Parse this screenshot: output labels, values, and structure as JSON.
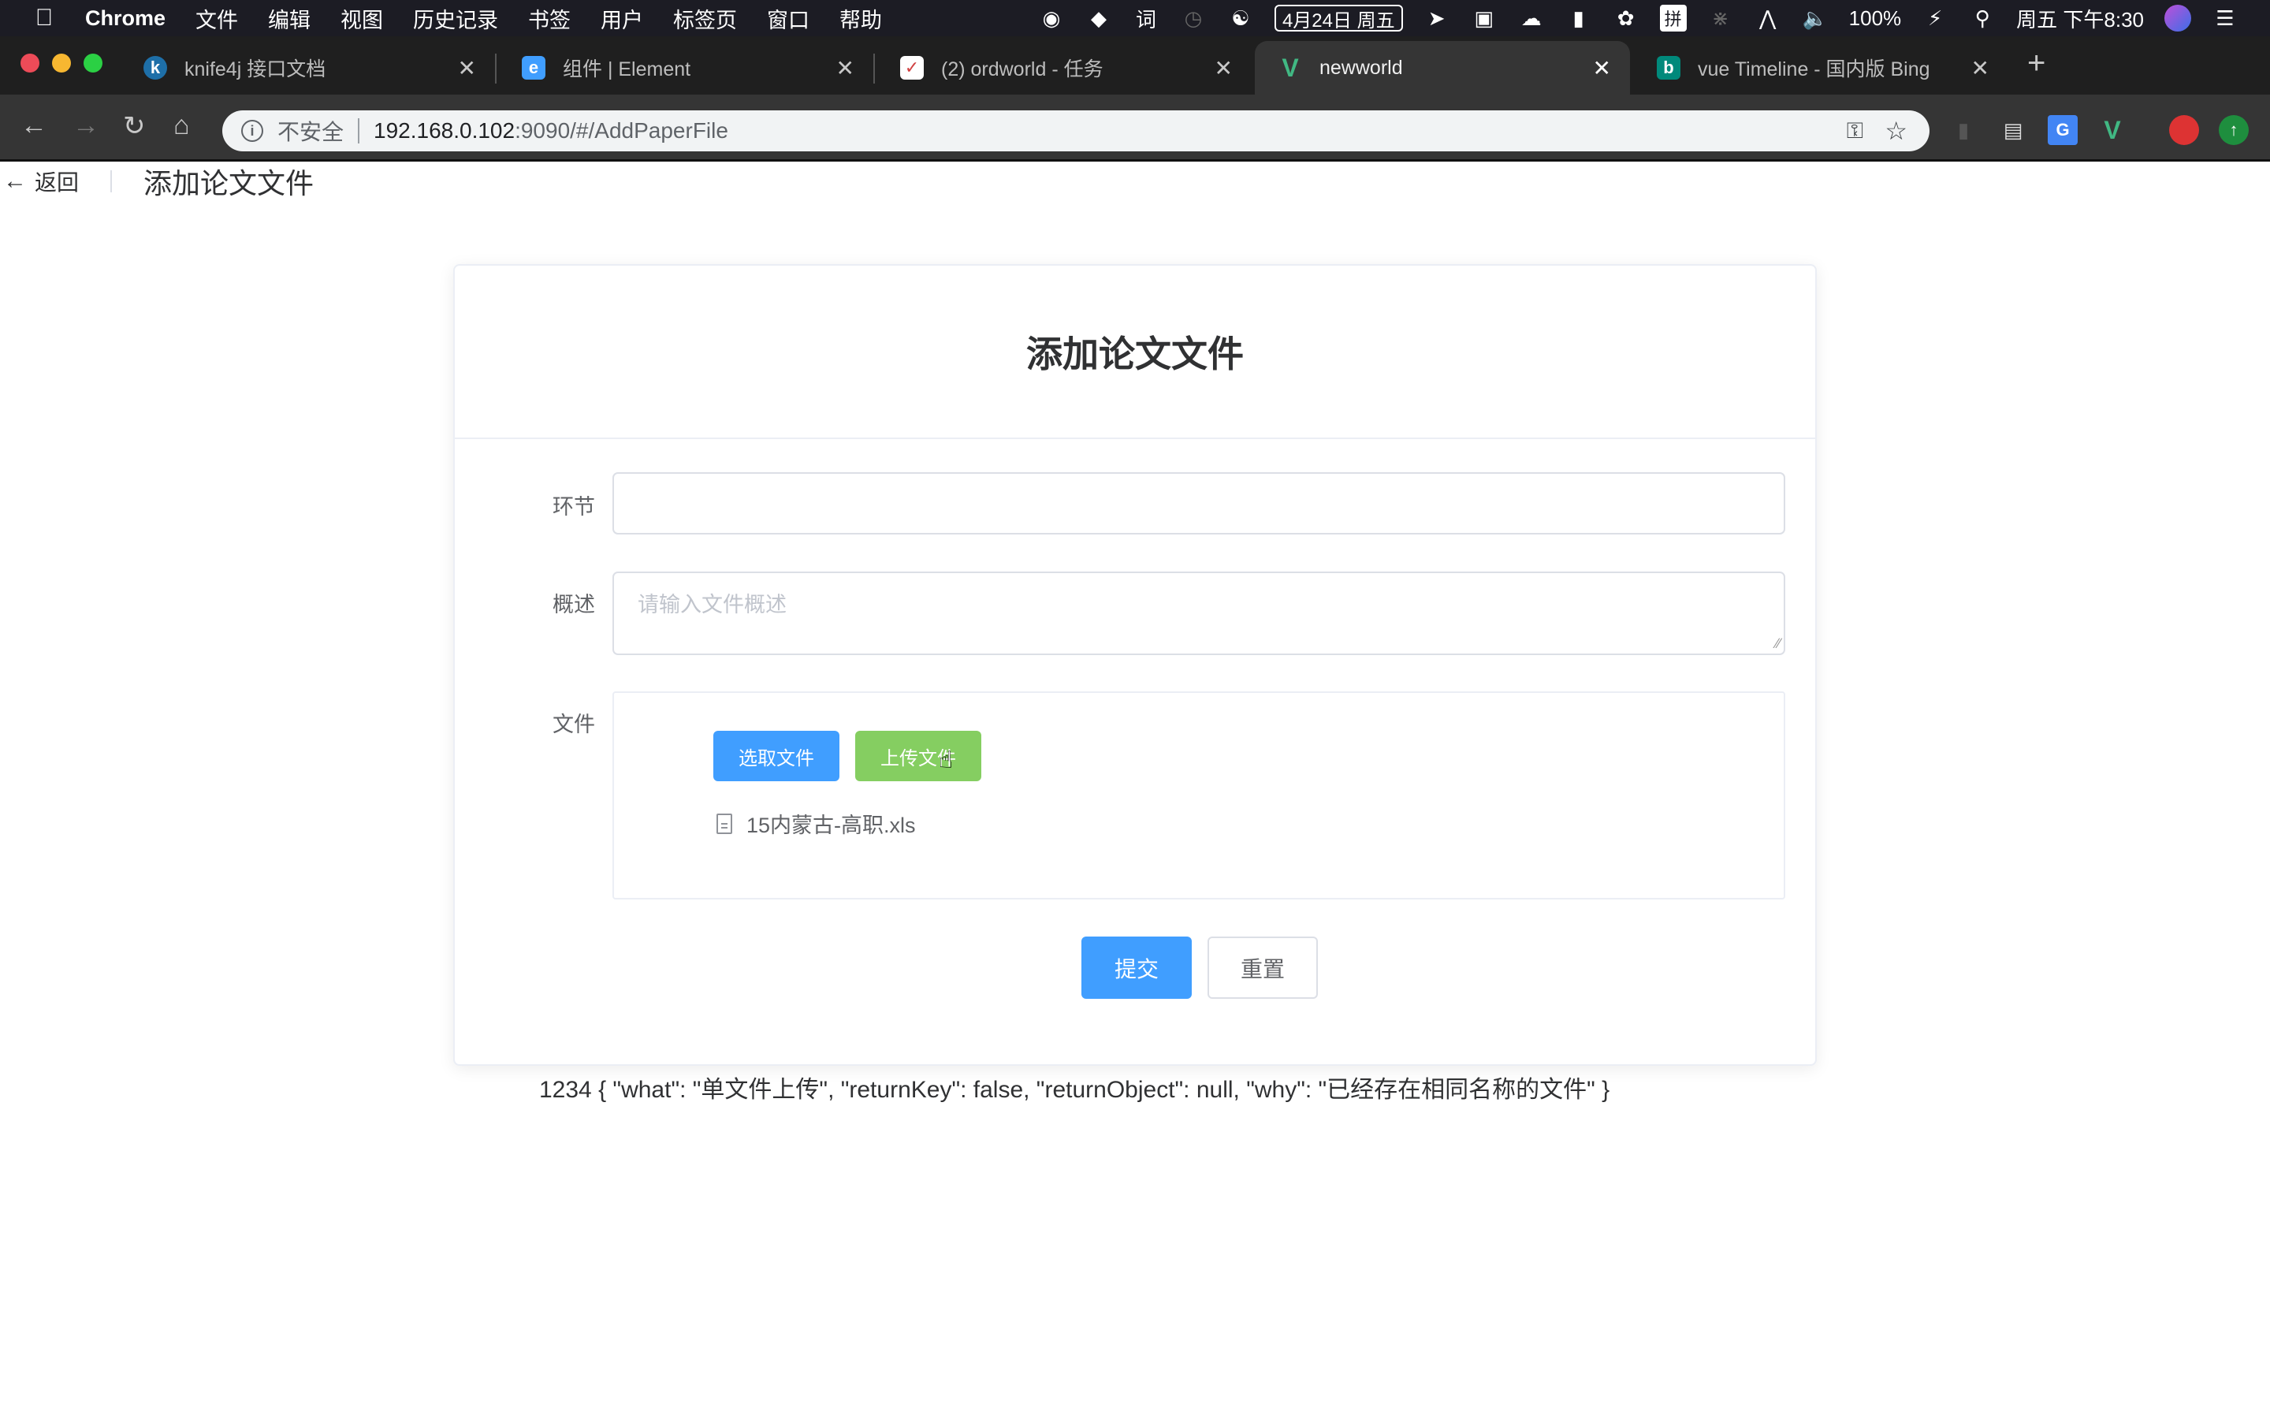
{
  "menubar": {
    "app_name": "Chrome",
    "items": [
      "文件",
      "编辑",
      "视图",
      "历史记录",
      "书签",
      "用户",
      "标签页",
      "窗口",
      "帮助"
    ],
    "status": {
      "date": "4月24日 周五",
      "battery": "100%",
      "clock": "周五 下午8:30",
      "ime": "拼"
    }
  },
  "tabs": [
    {
      "title": "knife4j 接口文档",
      "icon": "knife4j-icon",
      "active": false
    },
    {
      "title": "组件 | Element",
      "icon": "element-icon",
      "active": false
    },
    {
      "title": "(2) ordworld - 任务",
      "icon": "todo-icon",
      "active": false
    },
    {
      "title": "newworld",
      "icon": "vue-icon",
      "active": true
    },
    {
      "title": "vue Timeline - 国内版 Bing",
      "icon": "bing-icon",
      "active": false
    }
  ],
  "address": {
    "security_label": "不安全",
    "host": "192.168.0.102",
    "path": ":9090/#/AddPaperFile"
  },
  "page": {
    "back_label": "返回",
    "header_title": "添加论文文件",
    "card_title": "添加论文文件",
    "form": {
      "stage_label": "环节",
      "stage_value": "",
      "desc_label": "概述",
      "desc_placeholder": "请输入文件概述",
      "file_label": "文件",
      "select_button": "选取文件",
      "upload_button": "上传文件",
      "files": [
        "15内蒙古-高职.xls"
      ],
      "submit_button": "提交",
      "reset_button": "重置"
    },
    "response_text": "1234 { \"what\": \"单文件上传\", \"returnKey\": false, \"returnObject\": null, \"why\": \"已经存在相同名称的文件\" }"
  },
  "colors": {
    "primary": "#409eff",
    "success": "#85ce61",
    "border": "#dcdfe6",
    "text_primary": "#303133",
    "text_regular": "#606266"
  }
}
